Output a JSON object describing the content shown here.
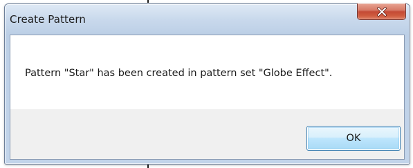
{
  "dialog": {
    "title": "Create Pattern",
    "close_icon": "close-icon",
    "message": "Pattern \"Star\" has been created in pattern set \"Globe Effect\".",
    "ok_label": "OK"
  },
  "colors": {
    "close_button": "#c44a35",
    "ok_button_border": "#3c7fb1",
    "window_border": "#6d7f99"
  }
}
